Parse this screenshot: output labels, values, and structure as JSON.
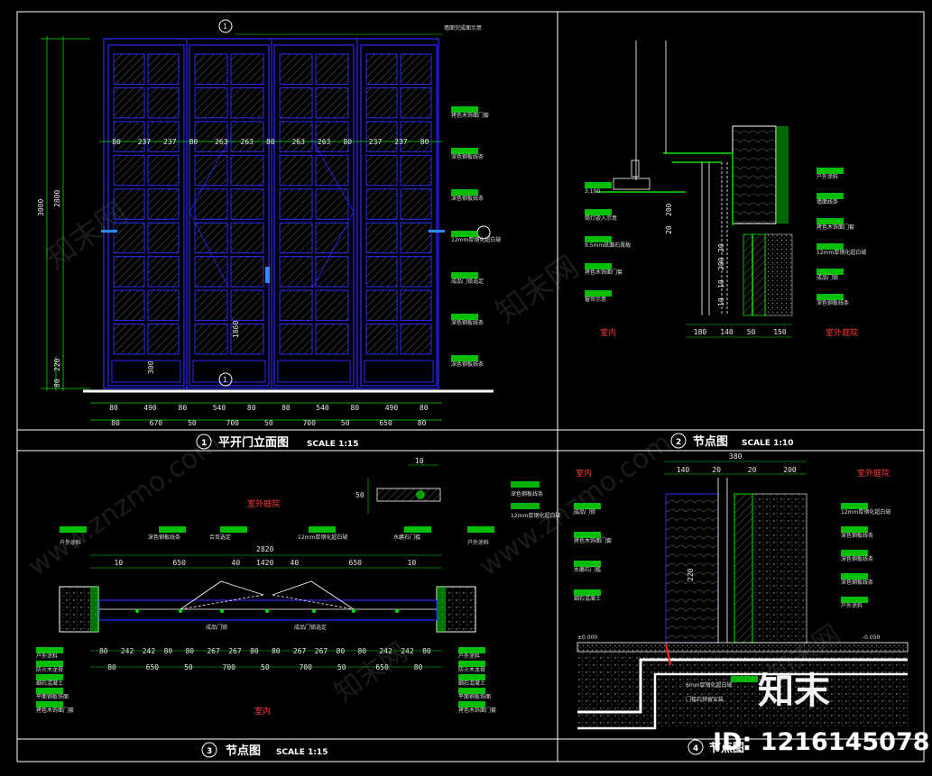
{
  "titles": {
    "t1": {
      "num": "1",
      "name": "平开门立面图",
      "scale": "SCALE 1:15"
    },
    "t2": {
      "num": "2",
      "name": "节点图",
      "scale": "SCALE 1:10"
    },
    "t3": {
      "num": "3",
      "name": "节点图",
      "scale": "SCALE 1:15"
    },
    "t4": {
      "num": "4",
      "name": "节点图"
    }
  },
  "elevation": {
    "top_note": "墙面完成面示意",
    "right_notes": [
      "拷色木饰面门套",
      "深色钢板线条",
      "深色钢板线条",
      "12mm厚钢化超白玻",
      "成品门锁选定",
      "深色钢板线条",
      "深色钢板线条"
    ],
    "panel_widths": [
      "80",
      "237",
      "237",
      "80",
      "263",
      "263",
      "80",
      "263",
      "263",
      "80",
      "237",
      "237",
      "80"
    ],
    "height_left": [
      "3000"
    ],
    "height_mid": [
      "2800",
      "220",
      "300"
    ],
    "height_small": [
      "80",
      "80"
    ],
    "middle_dim": "1860",
    "bottom_row1": [
      "80",
      "490",
      "80",
      "540",
      "80",
      "80",
      "540",
      "80",
      "490",
      "80"
    ],
    "bottom_row2": [
      "80",
      "670",
      "50",
      "700",
      "50",
      "700",
      "50",
      "650",
      "80"
    ],
    "marker_top": "1",
    "marker_bottom": "1"
  },
  "node2": {
    "labels_right": [
      "户外涂料",
      "墙面线条",
      "拷色木饰面门套",
      "12mm厚钢化超白玻",
      "成品门锁",
      "深色钢板线条"
    ],
    "labels_left": [
      "3.100",
      "筒灯嵌入示意",
      "9.5mm纸面石膏板",
      "拷色木饰面门套",
      "窗帘示意"
    ],
    "dims_bottom": [
      "180",
      "140",
      "50",
      "150"
    ],
    "dims_vert": [
      "200",
      "20",
      "20",
      "200",
      "10",
      "10"
    ],
    "room_in": "室内",
    "room_out": "室外庭院"
  },
  "node3": {
    "outdoor": "室外庭院",
    "indoor": "室内",
    "total": "2820",
    "inner": "1420",
    "top_row": [
      "10",
      "650",
      "40",
      "40",
      "650",
      "10"
    ],
    "top_notes": [
      "户外涂料",
      "深色钢板线条",
      "合页选定",
      "12mm厚钢化超白玻",
      "水磨石门槛",
      "户外涂料"
    ],
    "mid_notes": [
      "成品门锁",
      "成品门锁",
      "成品门锁选定"
    ],
    "bottom_row1": [
      "80",
      "242",
      "242",
      "80",
      "80",
      "267",
      "267",
      "80",
      "80",
      "267",
      "267",
      "80",
      "80",
      "242",
      "242",
      "80"
    ],
    "bottom_row2": [
      "80",
      "650",
      "50",
      "700",
      "50",
      "700",
      "50",
      "650",
      "80"
    ],
    "left_notes": [
      "户外涂料",
      "防火木龙骨",
      "细石混凝土",
      "平面钢板饰面",
      "拷色木饰面门套"
    ],
    "right_notes": [
      "户外涂料",
      "防火木龙骨",
      "细石混凝土",
      "平面钢板饰面",
      "拷色木饰面门套"
    ],
    "side_dims": [
      "80",
      "240",
      "5",
      "80",
      "240",
      "5"
    ],
    "inset_dims": [
      "10",
      "50",
      "10"
    ],
    "inset_notes": [
      "深色钢板线条",
      "12mm厚钢化超白玻"
    ]
  },
  "node4": {
    "indoor": "室内",
    "outdoor": "室外庭院",
    "width_total": "380",
    "widths": [
      "140",
      "20",
      "20",
      "200"
    ],
    "left_notes": [
      "成品门锁",
      "拷色木饰面门套",
      "水磨石门槛",
      "细石混凝土"
    ],
    "right_notes": [
      "12mm厚钢化超白玻",
      "深色钢板线条",
      "深色钢板线条",
      "深色钢板线条",
      "户外涂料"
    ],
    "vert_dim": "220",
    "level_left": "±0.000",
    "level_right": "-0.050",
    "bottom_notes": [
      "6mm厚钢化超白玻",
      "门槛石预留安装"
    ]
  },
  "watermark": {
    "site": "www.znzmo.com",
    "cn": "知末网",
    "brand": "知末",
    "id": "ID: 1216145078"
  },
  "colors": {
    "frame": "#2a2aff",
    "green": "#00e000",
    "white": "#ffffff",
    "red": "#ff2020",
    "hatch": "#7a7a7a"
  }
}
